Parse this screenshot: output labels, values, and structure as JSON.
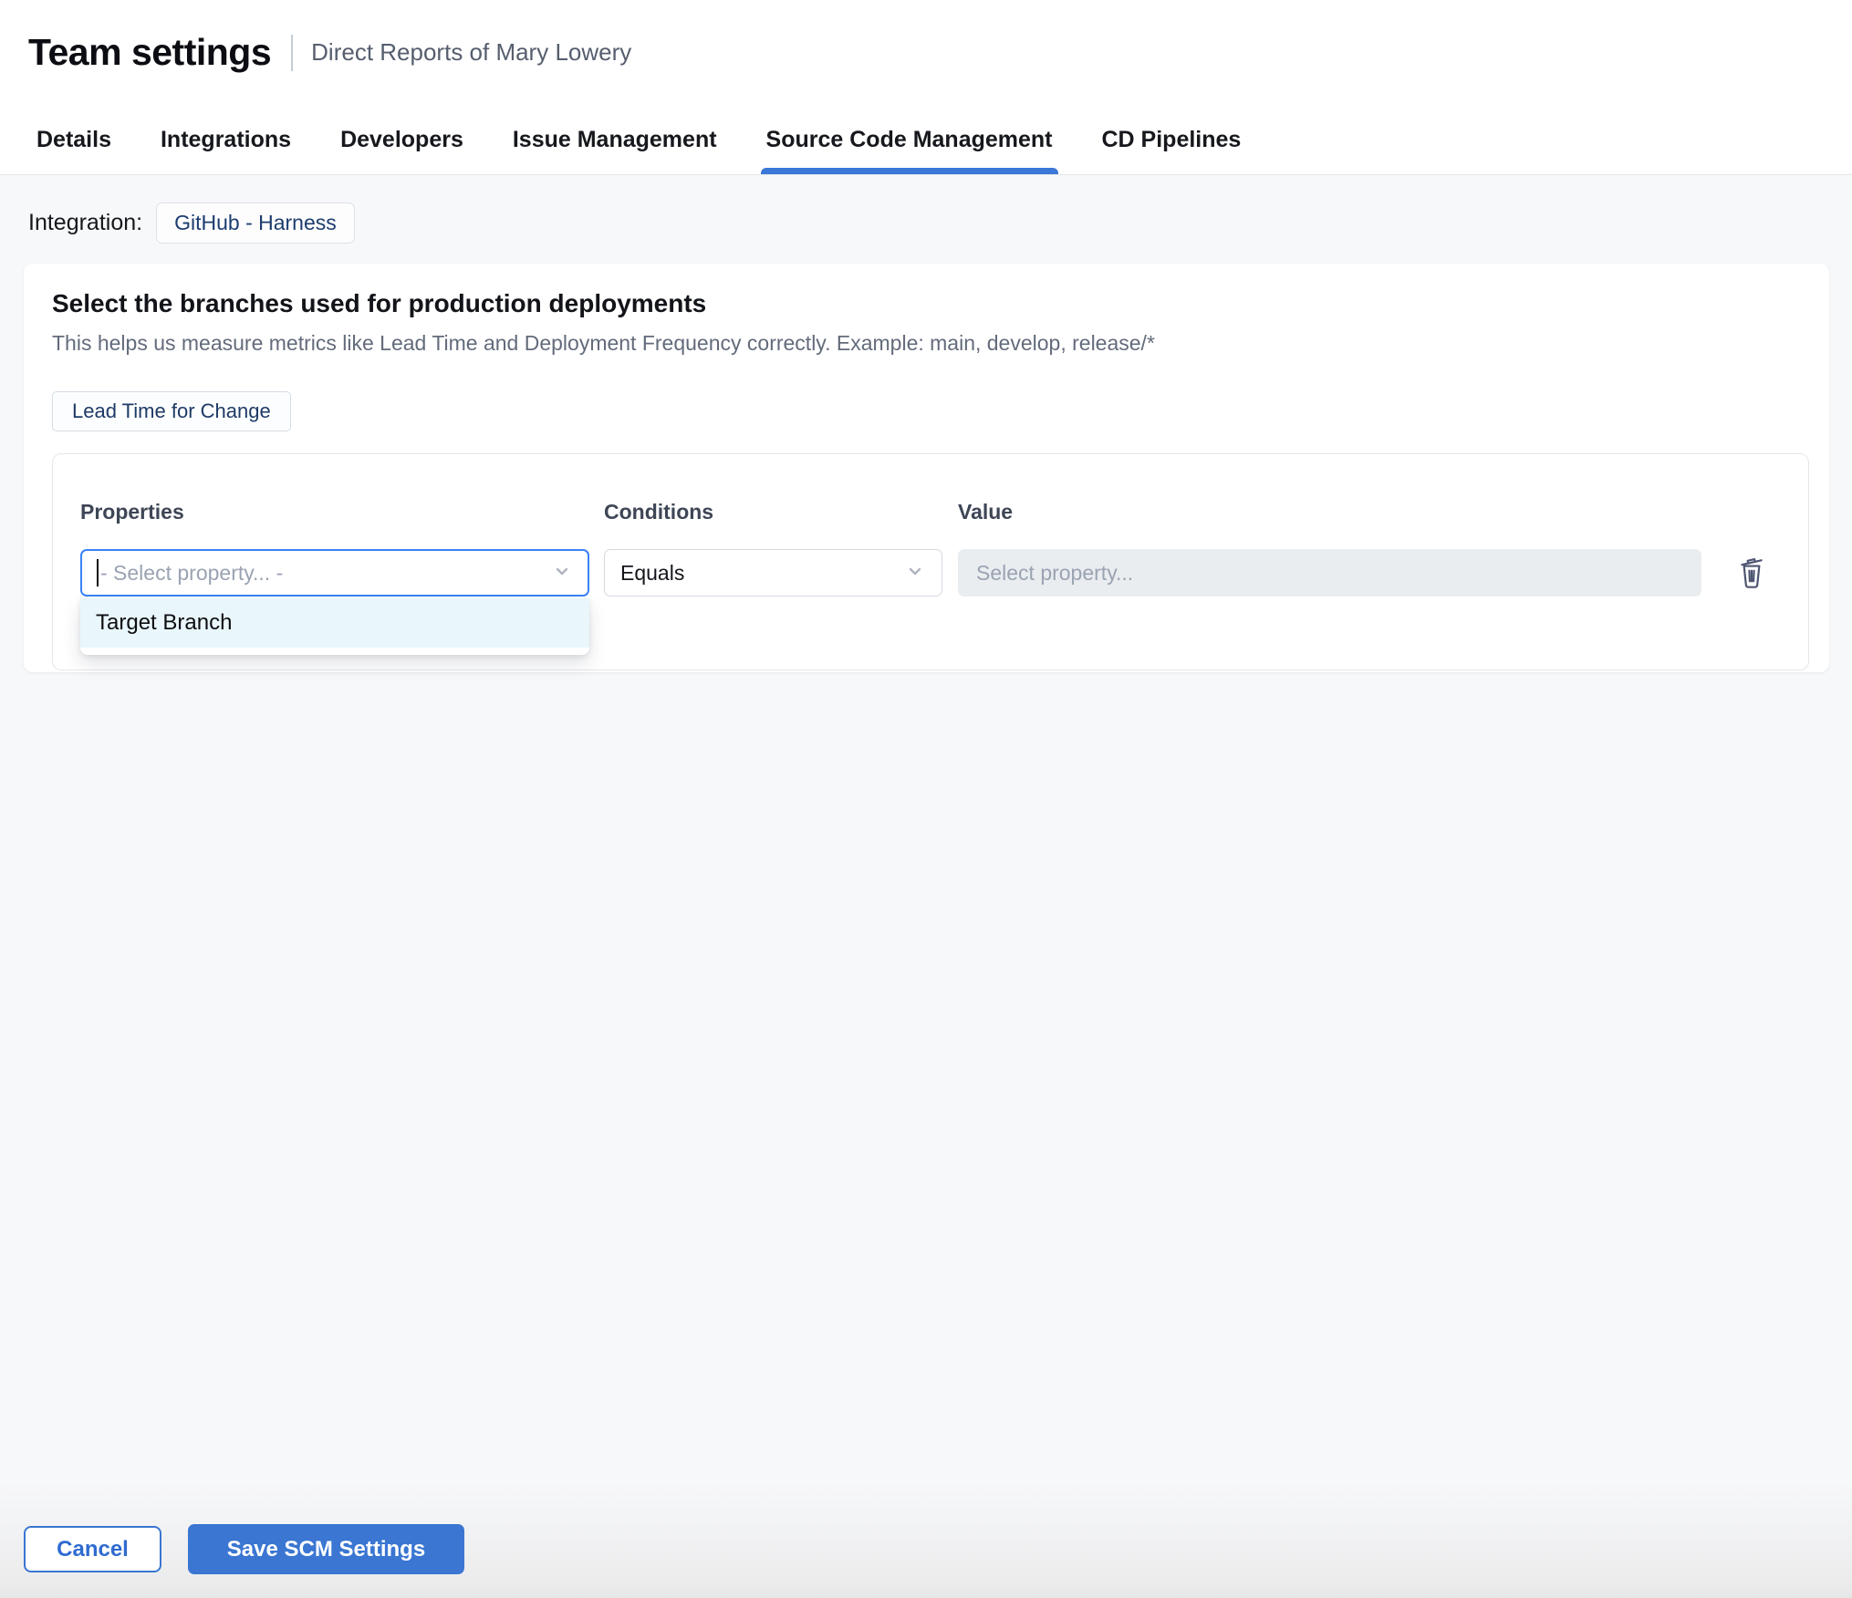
{
  "header": {
    "title": "Team settings",
    "subtitle": "Direct Reports of Mary Lowery"
  },
  "tabs": [
    {
      "label": "Details",
      "active": false
    },
    {
      "label": "Integrations",
      "active": false
    },
    {
      "label": "Developers",
      "active": false
    },
    {
      "label": "Issue Management",
      "active": false
    },
    {
      "label": "Source Code Management",
      "active": true
    },
    {
      "label": "CD Pipelines",
      "active": false
    }
  ],
  "integration": {
    "label": "Integration:",
    "chip": "GitHub - Harness"
  },
  "card": {
    "heading": "Select the branches used for production deployments",
    "description": "This helps us measure metrics like Lead Time and Deployment Frequency correctly. Example: main, develop, release/*",
    "metric_chip": "Lead Time for Change",
    "columns": {
      "properties": "Properties",
      "conditions": "Conditions",
      "value": "Value"
    },
    "property_select": {
      "placeholder": "- Select property... -"
    },
    "condition_select": {
      "value": "Equals"
    },
    "value_input": {
      "placeholder": "Select property..."
    },
    "dropdown": {
      "items": [
        "Target Branch"
      ]
    }
  },
  "footer": {
    "cancel_label": "Cancel",
    "save_label": "Save SCM Settings"
  },
  "colors": {
    "accent_blue": "#3a76d2",
    "focus_blue": "#3b82f6",
    "tab_underline": "#3b78d8",
    "chip_navy": "#1e3a66",
    "dropdown_highlight": "#e9f6fb",
    "disabled_input_bg": "#e9edf0",
    "page_bg": "#f7f8fa"
  }
}
